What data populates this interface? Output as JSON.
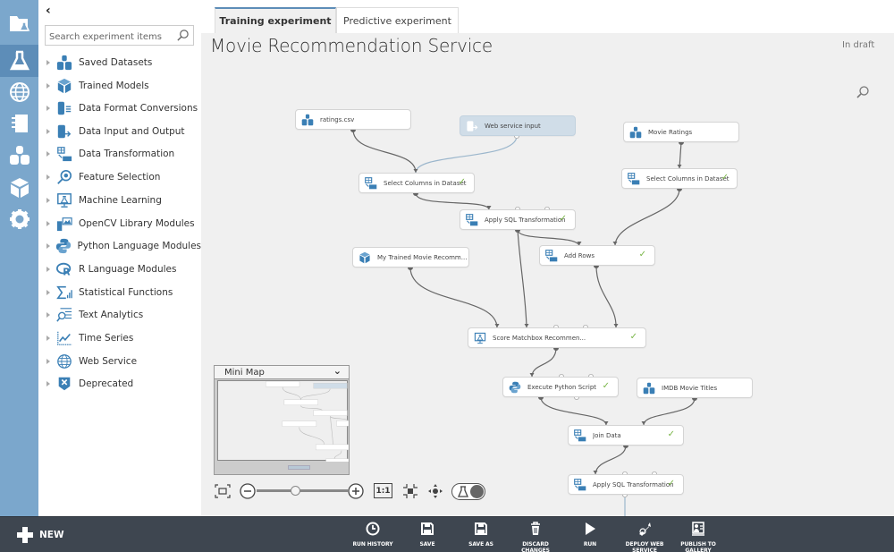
{
  "rail": {
    "items": [
      {
        "name": "projects",
        "icon": "folder-flask-icon"
      },
      {
        "name": "experiments",
        "icon": "flask-icon",
        "active": true
      },
      {
        "name": "web-services",
        "icon": "globe-icon"
      },
      {
        "name": "notebooks",
        "icon": "notebook-icon"
      },
      {
        "name": "datasets",
        "icon": "datasets-icon"
      },
      {
        "name": "trained-models",
        "icon": "cube-icon"
      },
      {
        "name": "settings",
        "icon": "gear-icon"
      }
    ]
  },
  "palette": {
    "collapse_glyph": "‹",
    "search": {
      "placeholder": "Search experiment items",
      "value": ""
    },
    "items": [
      {
        "label": "Saved Datasets",
        "icon": "datasets-icon"
      },
      {
        "label": "Trained Models",
        "icon": "cube-icon"
      },
      {
        "label": "Data Format Conversions",
        "icon": "data-format-icon"
      },
      {
        "label": "Data Input and Output",
        "icon": "data-io-icon"
      },
      {
        "label": "Data Transformation",
        "icon": "data-transform-icon"
      },
      {
        "label": "Feature Selection",
        "icon": "feature-selection-icon"
      },
      {
        "label": "Machine Learning",
        "icon": "machine-learning-icon"
      },
      {
        "label": "OpenCV Library Modules",
        "icon": "opencv-icon"
      },
      {
        "label": "Python Language Modules",
        "icon": "python-icon"
      },
      {
        "label": "R Language Modules",
        "icon": "r-icon"
      },
      {
        "label": "Statistical Functions",
        "icon": "sigma-icon"
      },
      {
        "label": "Text Analytics",
        "icon": "text-analytics-icon"
      },
      {
        "label": "Time Series",
        "icon": "time-series-icon"
      },
      {
        "label": "Web Service",
        "icon": "globe-icon"
      },
      {
        "label": "Deprecated",
        "icon": "deprecated-icon"
      }
    ]
  },
  "tabs": [
    {
      "label": "Training experiment",
      "active": true
    },
    {
      "label": "Predictive experiment",
      "active": false
    }
  ],
  "experiment": {
    "title": "Movie Recommendation Service",
    "status": "In draft"
  },
  "nodes": [
    {
      "id": "ratings",
      "label": "ratings.csv",
      "icon": "dataset-icon",
      "check": false
    },
    {
      "id": "wsi",
      "label": "Web service input",
      "icon": "web-service-input-icon",
      "check": false
    },
    {
      "id": "movieratings",
      "label": "Movie Ratings",
      "icon": "dataset-icon",
      "check": false
    },
    {
      "id": "selcol1",
      "label": "Select Columns in Dataset",
      "icon": "transform-icon",
      "check": true
    },
    {
      "id": "selcol2",
      "label": "Select Columns in Dataset",
      "icon": "transform-icon",
      "check": true
    },
    {
      "id": "sql1",
      "label": "Apply SQL Transformation",
      "icon": "transform-icon",
      "check": true
    },
    {
      "id": "trained",
      "label": "My Trained Movie Recomm...",
      "icon": "trained-model-icon",
      "check": false
    },
    {
      "id": "addrows",
      "label": "Add Rows",
      "icon": "transform-icon",
      "check": true
    },
    {
      "id": "score",
      "label": "Score Matchbox Recommen...",
      "icon": "machine-learning-icon",
      "check": true
    },
    {
      "id": "python",
      "label": "Execute Python Script",
      "icon": "python-icon",
      "check": true
    },
    {
      "id": "imdb",
      "label": "IMDB Movie Titles",
      "icon": "dataset-icon",
      "check": false
    },
    {
      "id": "join",
      "label": "Join Data",
      "icon": "transform-icon",
      "check": true
    },
    {
      "id": "sql2",
      "label": "Apply SQL Transformation",
      "icon": "transform-icon",
      "check": true
    }
  ],
  "check_glyph": "✓",
  "minimap": {
    "title": "Mini Map",
    "toggle_glyph": "⌄"
  },
  "zoom_controls": {
    "fit_label": "fit-to-screen",
    "actual_size_label": "1:1",
    "zoom_level": 0.42
  },
  "bottombar": {
    "new_label": "NEW",
    "commands": [
      {
        "label": "RUN HISTORY",
        "icon": "clock-icon"
      },
      {
        "label": "SAVE",
        "icon": "save-icon"
      },
      {
        "label": "SAVE AS",
        "icon": "save-as-icon"
      },
      {
        "label": "DISCARD CHANGES",
        "icon": "trash-icon"
      },
      {
        "label": "RUN",
        "icon": "play-icon"
      },
      {
        "label": "DEPLOY WEB\nSERVICE",
        "icon": "deploy-icon"
      },
      {
        "label": "PUBLISH TO\nGALLERY",
        "icon": "publish-icon"
      }
    ]
  },
  "colors": {
    "rail": "#7ba7cc",
    "rail_active": "#5d8db8",
    "bottombar": "#3e4650",
    "check": "#7ab648",
    "accent_icon": "#3a7fb5"
  }
}
